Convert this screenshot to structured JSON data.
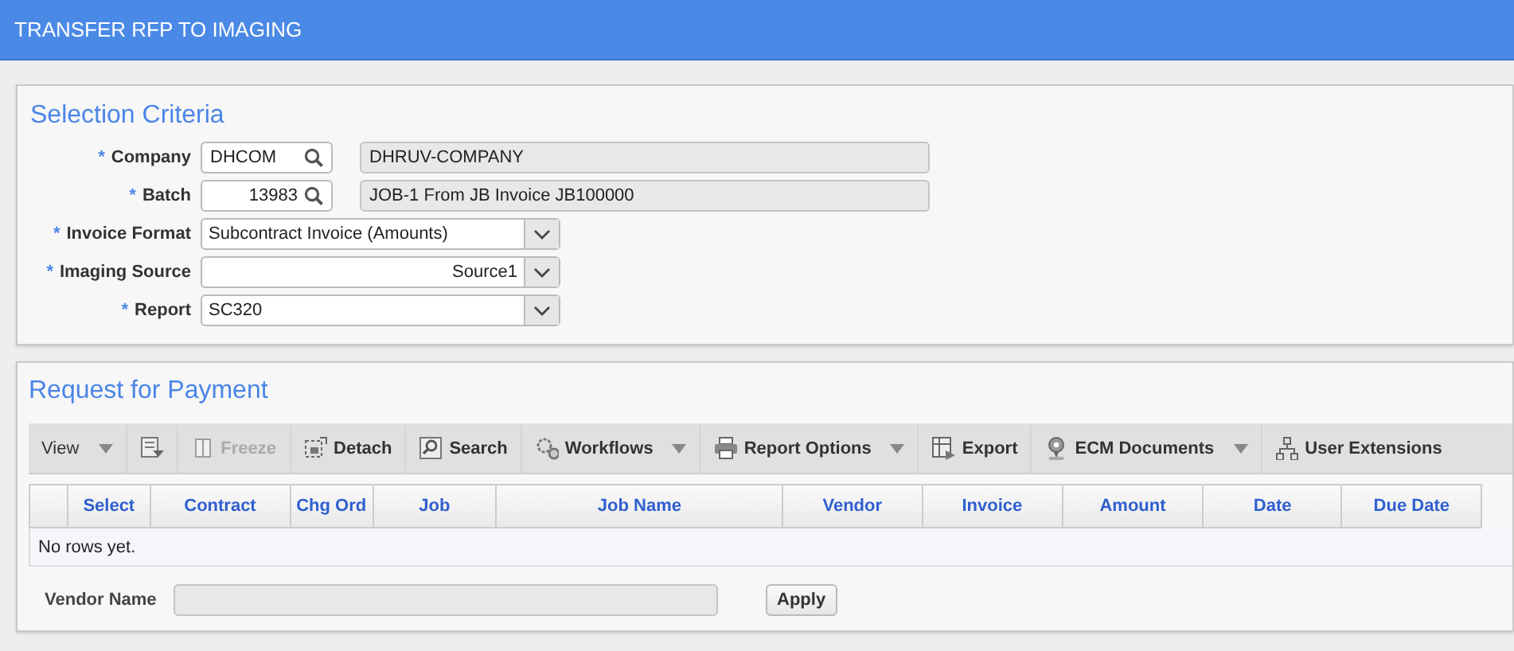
{
  "header": {
    "title": "TRANSFER RFP TO IMAGING"
  },
  "selection_criteria": {
    "title": "Selection Criteria",
    "fields": [
      {
        "kind": "lookup",
        "required_mark": "*",
        "label": "Company",
        "value": "DHCOM",
        "right_aligned": false,
        "description": "DHRUV-COMPANY"
      },
      {
        "kind": "lookup",
        "required_mark": "*",
        "label": "Batch",
        "value": "13983",
        "right_aligned": true,
        "description": "JOB-1 From JB Invoice JB100000"
      },
      {
        "kind": "select",
        "required_mark": "*",
        "label": "Invoice Format",
        "value": "Subcontract Invoice (Amounts)",
        "right_aligned": false
      },
      {
        "kind": "select",
        "required_mark": "*",
        "label": "Imaging Source",
        "value": "Source1",
        "right_aligned": true
      },
      {
        "kind": "select",
        "required_mark": "*",
        "label": "Report",
        "value": "SC320",
        "right_aligned": false
      }
    ]
  },
  "request_for_payment": {
    "title": "Request for Payment",
    "toolbar": [
      {
        "label": "View",
        "dropdown": true,
        "disabled": false
      },
      {
        "dropdown": false,
        "disabled": false
      },
      {
        "label": "Freeze",
        "dropdown": false,
        "disabled": true
      },
      {
        "label": "Detach",
        "dropdown": false,
        "disabled": false
      },
      {
        "label": "Search",
        "dropdown": false,
        "disabled": false
      },
      {
        "label": "Workflows",
        "dropdown": true,
        "disabled": false
      },
      {
        "label": "Report Options",
        "dropdown": true,
        "disabled": false
      },
      {
        "label": "Export",
        "dropdown": false,
        "disabled": false
      },
      {
        "label": "ECM Documents",
        "dropdown": true,
        "disabled": false
      },
      {
        "label": "User Extensions",
        "dropdown": false,
        "disabled": false
      }
    ],
    "table": {
      "columns": [
        "Select",
        "Contract",
        "Chg Ord",
        "Job",
        "Job Name",
        "Vendor",
        "Invoice",
        "Amount",
        "Date",
        "Due Date"
      ],
      "empty_message": "No rows yet."
    },
    "filter": {
      "label": "Vendor Name",
      "button": "Apply"
    }
  }
}
